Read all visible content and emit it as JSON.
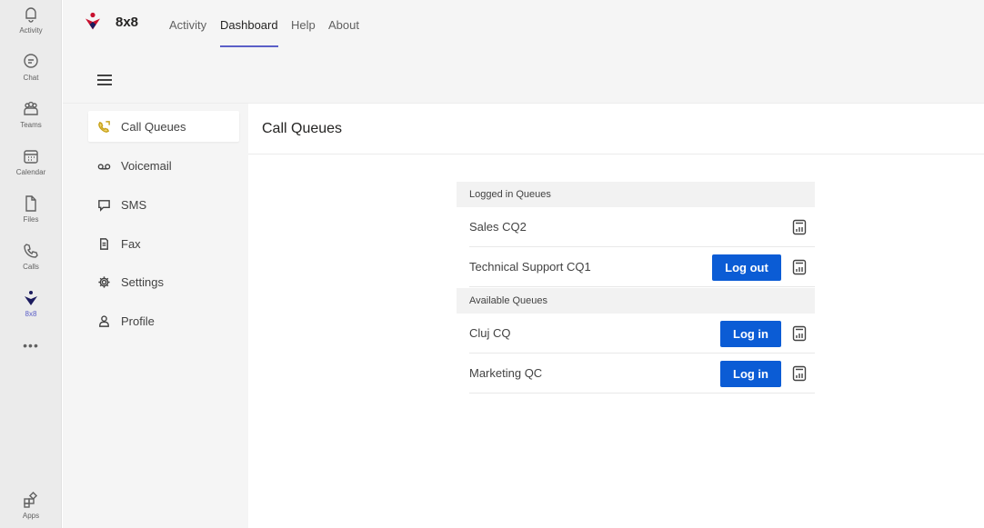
{
  "rail": {
    "items": [
      {
        "label": "Activity",
        "icon": "bell-icon"
      },
      {
        "label": "Chat",
        "icon": "chat-icon"
      },
      {
        "label": "Teams",
        "icon": "teams-icon"
      },
      {
        "label": "Calendar",
        "icon": "calendar-icon"
      },
      {
        "label": "Files",
        "icon": "file-icon"
      },
      {
        "label": "Calls",
        "icon": "phone-icon"
      },
      {
        "label": "8x8",
        "icon": "8x8-logo-icon"
      },
      {
        "label": "Apps",
        "icon": "apps-icon"
      }
    ],
    "more": "•••"
  },
  "header": {
    "brand": "8x8",
    "tabs": [
      "Activity",
      "Dashboard",
      "Help",
      "About"
    ],
    "active_tab": "Dashboard"
  },
  "sidebar": {
    "items": [
      {
        "label": "Call Queues",
        "icon": "call-queue-icon",
        "active": true
      },
      {
        "label": "Voicemail",
        "icon": "voicemail-icon"
      },
      {
        "label": "SMS",
        "icon": "sms-icon"
      },
      {
        "label": "Fax",
        "icon": "fax-icon"
      },
      {
        "label": "Settings",
        "icon": "gear-icon"
      },
      {
        "label": "Profile",
        "icon": "person-icon"
      }
    ]
  },
  "main": {
    "title": "Call Queues",
    "logged_in": {
      "heading": "Logged in Queues",
      "queues": [
        {
          "name": "Sales CQ2",
          "action": ""
        },
        {
          "name": "Technical Support CQ1",
          "action": "Log out"
        }
      ]
    },
    "available": {
      "heading": "Available Queues",
      "queues": [
        {
          "name": "Cluj CQ",
          "action": "Log in"
        },
        {
          "name": "Marketing QC",
          "action": "Log in"
        }
      ]
    }
  },
  "colors": {
    "accent": "#5b5fc7",
    "button": "#0b5cd5",
    "brand_red": "#c8102e"
  }
}
